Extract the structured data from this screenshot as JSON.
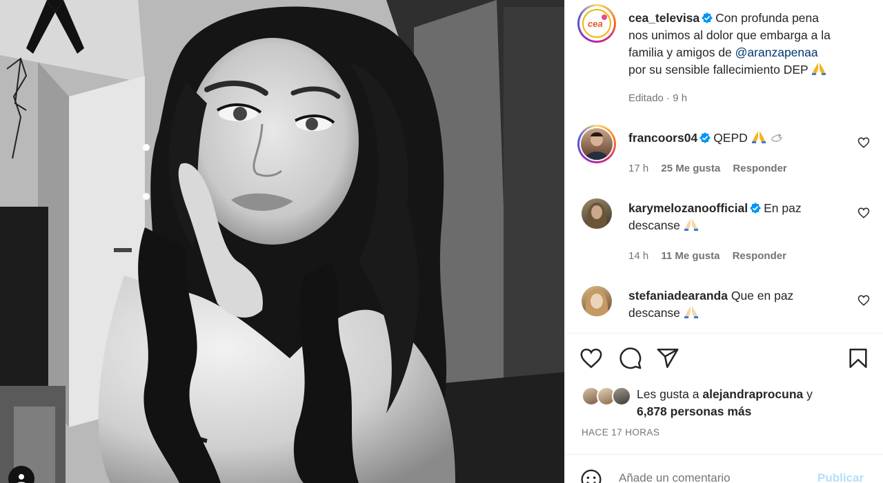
{
  "post": {
    "author": "cea_televisa",
    "caption_line1": "Con profunda pena",
    "caption_line2": "nos unimos al dolor que embarga a la",
    "caption_line3_prefix": "familia y amigos de",
    "mention": "@aranzapenaa",
    "caption_line4": "por su sensible fallecimiento DEP",
    "caption_emoji": "folded-hands",
    "edited_label": "Editado · 9 h"
  },
  "comments": [
    {
      "username": "francoors04",
      "verified": true,
      "text": "QEPD",
      "emojis": [
        "folded-hands",
        "dove"
      ],
      "time": "17 h",
      "likes": "25 Me gusta",
      "reply_label": "Responder",
      "avatar_ring": true
    },
    {
      "username": "karymelozanoofficial",
      "verified": true,
      "text_line1": "En paz",
      "text_line2": "descanse",
      "emojis": [
        "folded-hands"
      ],
      "time": "14 h",
      "likes": "11 Me gusta",
      "reply_label": "Responder",
      "avatar_ring": false
    },
    {
      "username": "stefaniadearanda",
      "verified": false,
      "text_line1": "Que en paz",
      "text_line2": "descanse",
      "emojis": [
        "folded-hands"
      ],
      "avatar_ring": false
    }
  ],
  "actions": {
    "like_icon": "heart-icon",
    "comment_icon": "comment-icon",
    "share_icon": "paper-plane-icon",
    "save_icon": "bookmark-icon"
  },
  "likes": {
    "prefix": "Les gusta a",
    "first_liker": "alejandraprocuna",
    "conjunction": "y",
    "others": "6,878 personas más"
  },
  "time_ago": "HACE 17 HORAS",
  "comment_box": {
    "placeholder": "Añade un comentario...",
    "visible_placeholder": "Añade un comentario",
    "publish_label": "Publicar"
  },
  "colors": {
    "text": "#262626",
    "secondary": "#737373",
    "mention": "#00376b",
    "verified_blue": "#0095f6",
    "publish_disabled": "#b2dffc"
  }
}
